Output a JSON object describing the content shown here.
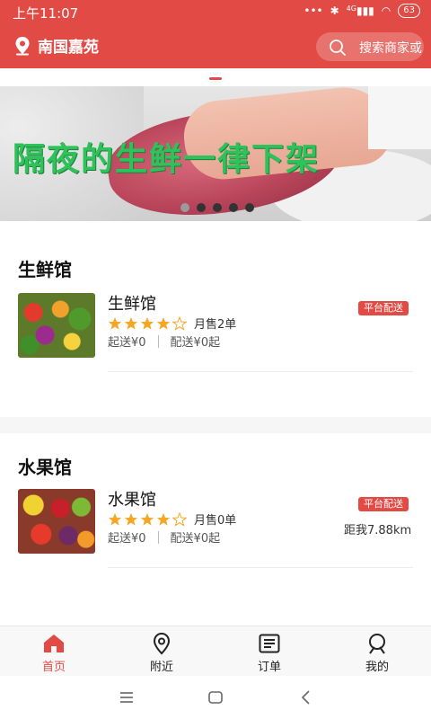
{
  "status_bar": {
    "time": "上午11:07",
    "signal_label": "4G",
    "battery": "63"
  },
  "header": {
    "location": "南国嘉苑",
    "search_placeholder": "搜索商家或"
  },
  "banner": {
    "text": "隔夜的生鲜一律下架",
    "slide_count": 5,
    "active_slide": 1
  },
  "sections": [
    {
      "title": "生鲜馆",
      "shop": {
        "name": "生鲜馆",
        "rating": 4,
        "max_rating": 5,
        "monthly_sales": "月售2单",
        "min_order": "起送¥0",
        "delivery_fee": "配送¥0起",
        "badge": "平台配送",
        "distance": ""
      }
    },
    {
      "title": "水果馆",
      "shop": {
        "name": "水果馆",
        "rating": 4,
        "max_rating": 5,
        "monthly_sales": "月售0单",
        "min_order": "起送¥0",
        "delivery_fee": "配送¥0起",
        "badge": "平台配送",
        "distance": "距我7.88km"
      }
    }
  ],
  "bottom_nav": [
    {
      "label": "首页",
      "icon": "home-icon",
      "active": true
    },
    {
      "label": "附近",
      "icon": "location-pin-icon",
      "active": false
    },
    {
      "label": "订单",
      "icon": "order-list-icon",
      "active": false
    },
    {
      "label": "我的",
      "icon": "user-icon",
      "active": false
    }
  ],
  "colors": {
    "brand": "#e24b45",
    "banner_text": "#2fc25b",
    "star": "#f5a623"
  }
}
